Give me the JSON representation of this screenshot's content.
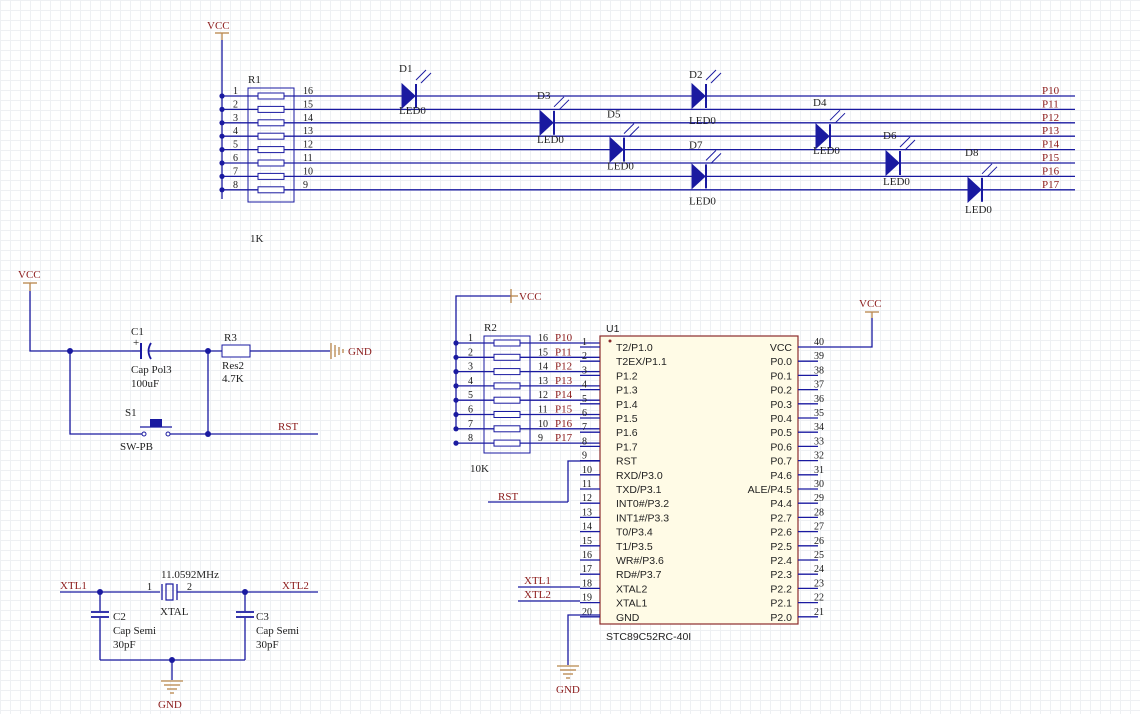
{
  "power": {
    "vcc": "VCC",
    "gnd": "GND"
  },
  "r1": {
    "designator": "R1",
    "value": "1K",
    "left_pins": [
      "1",
      "2",
      "3",
      "4",
      "5",
      "6",
      "7",
      "8"
    ],
    "right_pins": [
      "16",
      "15",
      "14",
      "13",
      "12",
      "11",
      "10",
      "9"
    ]
  },
  "led_nets": [
    "P10",
    "P11",
    "P12",
    "P13",
    "P14",
    "P15",
    "P16",
    "P17"
  ],
  "leds": [
    {
      "designator": "D1",
      "value": "LED0"
    },
    {
      "designator": "D3",
      "value": "LED0"
    },
    {
      "designator": "D2",
      "value": "LED0"
    },
    {
      "designator": "D5",
      "value": "LED0"
    },
    {
      "designator": "D4",
      "value": "LED0"
    },
    {
      "designator": "D7",
      "value": "LED0"
    },
    {
      "designator": "D6",
      "value": "LED0"
    },
    {
      "designator": "D8",
      "value": "LED0"
    }
  ],
  "reset": {
    "c1": {
      "designator": "C1",
      "comment": "Cap Pol3",
      "value": "100uF"
    },
    "r3": {
      "designator": "R3",
      "comment": "Res2",
      "value": "4.7K"
    },
    "s1": {
      "designator": "S1",
      "comment": "SW-PB"
    },
    "net": "RST",
    "c1_plus": "+"
  },
  "osc": {
    "net_left": "XTL1",
    "net_right": "XTL2",
    "crystal": {
      "value": "11.0592MHz",
      "comment": "XTAL",
      "pin1": "1",
      "pin2": "2"
    },
    "c2": {
      "designator": "C2",
      "comment": "Cap Semi",
      "value": "30pF"
    },
    "c3": {
      "designator": "C3",
      "comment": "Cap Semi",
      "value": "30pF"
    }
  },
  "r2": {
    "designator": "R2",
    "value": "10K",
    "left_pins": [
      "1",
      "2",
      "3",
      "4",
      "5",
      "6",
      "7",
      "8"
    ],
    "right_pins": [
      "16",
      "15",
      "14",
      "13",
      "12",
      "11",
      "10",
      "9"
    ],
    "nets": [
      "P10",
      "P11",
      "P12",
      "P13",
      "P14",
      "P15",
      "P16",
      "P17"
    ]
  },
  "u1": {
    "designator": "U1",
    "part": "STC89C52RC-40I",
    "left": [
      {
        "num": "1",
        "name": "T2/P1.0"
      },
      {
        "num": "2",
        "name": "T2EX/P1.1"
      },
      {
        "num": "3",
        "name": "P1.2"
      },
      {
        "num": "4",
        "name": "P1.3"
      },
      {
        "num": "5",
        "name": "P1.4"
      },
      {
        "num": "6",
        "name": "P1.5"
      },
      {
        "num": "7",
        "name": "P1.6"
      },
      {
        "num": "8",
        "name": "P1.7"
      },
      {
        "num": "9",
        "name": "RST"
      },
      {
        "num": "10",
        "name": "RXD/P3.0"
      },
      {
        "num": "11",
        "name": "TXD/P3.1"
      },
      {
        "num": "12",
        "name": "INT0#/P3.2"
      },
      {
        "num": "13",
        "name": "INT1#/P3.3"
      },
      {
        "num": "14",
        "name": "T0/P3.4"
      },
      {
        "num": "15",
        "name": "T1/P3.5"
      },
      {
        "num": "16",
        "name": "WR#/P3.6"
      },
      {
        "num": "17",
        "name": "RD#/P3.7"
      },
      {
        "num": "18",
        "name": "XTAL2"
      },
      {
        "num": "19",
        "name": "XTAL1"
      },
      {
        "num": "20",
        "name": "GND"
      }
    ],
    "right": [
      {
        "num": "40",
        "name": "VCC"
      },
      {
        "num": "39",
        "name": "P0.0"
      },
      {
        "num": "38",
        "name": "P0.1"
      },
      {
        "num": "37",
        "name": "P0.2"
      },
      {
        "num": "36",
        "name": "P0.3"
      },
      {
        "num": "35",
        "name": "P0.4"
      },
      {
        "num": "34",
        "name": "P0.5"
      },
      {
        "num": "33",
        "name": "P0.6"
      },
      {
        "num": "32",
        "name": "P0.7"
      },
      {
        "num": "31",
        "name": "P4.6"
      },
      {
        "num": "30",
        "name": "ALE/P4.5"
      },
      {
        "num": "29",
        "name": "P4.4"
      },
      {
        "num": "28",
        "name": "P2.7"
      },
      {
        "num": "27",
        "name": "P2.6"
      },
      {
        "num": "26",
        "name": "P2.5"
      },
      {
        "num": "25",
        "name": "P2.4"
      },
      {
        "num": "24",
        "name": "P2.3"
      },
      {
        "num": "23",
        "name": "P2.2"
      },
      {
        "num": "22",
        "name": "P2.1"
      },
      {
        "num": "21",
        "name": "P2.0"
      }
    ],
    "rst_net": "RST",
    "xtl1_net": "XTL1",
    "xtl2_net": "XTL2"
  }
}
